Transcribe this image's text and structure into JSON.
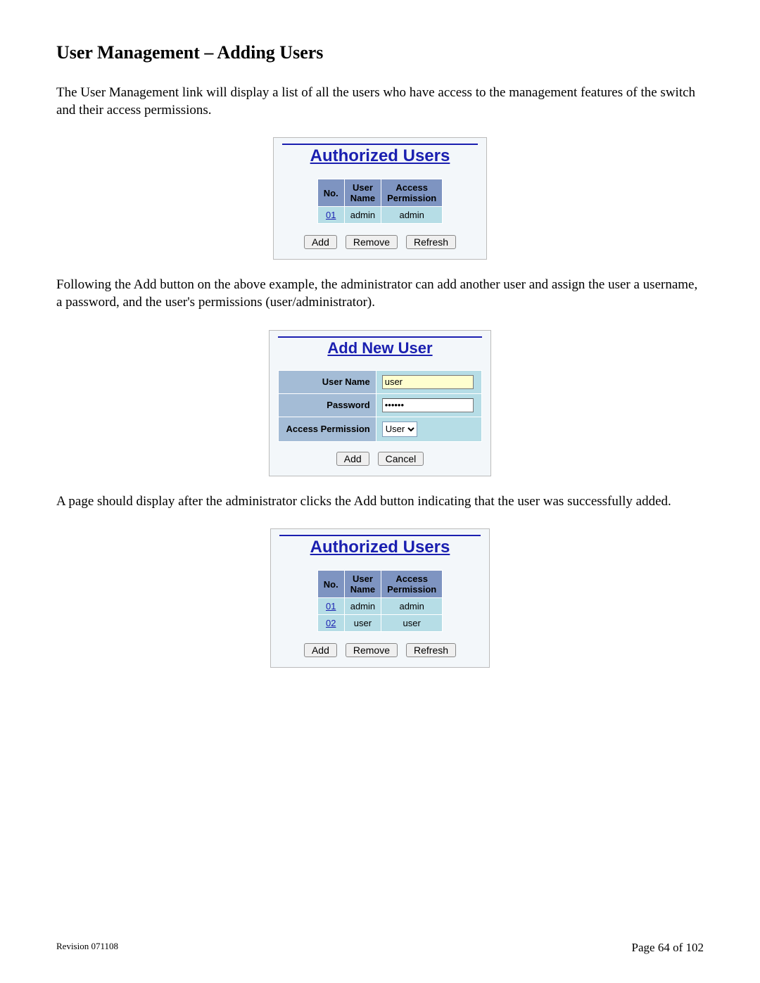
{
  "title": "User Management – Adding Users",
  "para1": "The User Management link will display a list of all the users who have access to the management features of the switch and their access permissions.",
  "para2": "Following the Add button on the above example, the administrator can add another user and assign the user a username, a password, and the user's permissions (user/administrator).",
  "para3": "A page should display after the administrator clicks the Add button indicating that the user was successfully added.",
  "panel1": {
    "title": "Authorized Users",
    "headers": {
      "no": "No.",
      "name": "User\nName",
      "perm": "Access\nPermission"
    },
    "rows": [
      {
        "no": "01",
        "name": "admin",
        "perm": "admin"
      }
    ],
    "buttons": {
      "add": "Add",
      "remove": "Remove",
      "refresh": "Refresh"
    }
  },
  "panel2": {
    "title": "Add New User",
    "labels": {
      "user": "User Name",
      "pwd": "Password",
      "perm": "Access Permission"
    },
    "values": {
      "user": "user",
      "pwd": "••••••",
      "perm": "User"
    },
    "buttons": {
      "add": "Add",
      "cancel": "Cancel"
    }
  },
  "panel3": {
    "title": "Authorized Users",
    "headers": {
      "no": "No.",
      "name": "User\nName",
      "perm": "Access\nPermission"
    },
    "rows": [
      {
        "no": "01",
        "name": "admin",
        "perm": "admin"
      },
      {
        "no": "02",
        "name": "user",
        "perm": "user"
      }
    ],
    "buttons": {
      "add": "Add",
      "remove": "Remove",
      "refresh": "Refresh"
    }
  },
  "footer": {
    "revision": "Revision 071108",
    "page": "Page 64 of 102"
  }
}
